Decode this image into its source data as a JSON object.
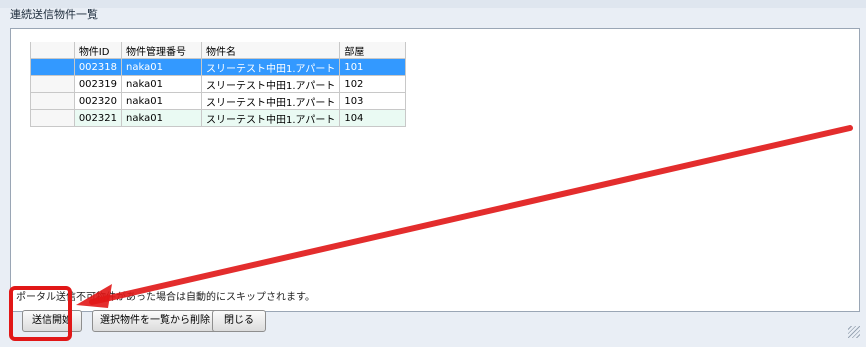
{
  "window": {
    "title": "連続送信物件一覧"
  },
  "table": {
    "headers": [
      "物件ID",
      "物件管理番号",
      "物件名",
      "部屋"
    ],
    "rows": [
      [
        "002318",
        "naka01",
        "スリーテスト中田1.アパート",
        "101"
      ],
      [
        "002319",
        "naka01",
        "スリーテスト中田1.アパート",
        "102"
      ],
      [
        "002320",
        "naka01",
        "スリーテスト中田1.アパート",
        "103"
      ],
      [
        "002321",
        "naka01",
        "スリーテスト中田1.アパート",
        "104"
      ]
    ],
    "selected_row": 0
  },
  "footer": {
    "note": "ポータル送信不可物件があった場合は自動的にスキップされます。"
  },
  "buttons": {
    "start": "送信開始",
    "remove": "選択物件を一覧から削除",
    "close": "閉じる"
  },
  "annotation": {
    "color": "#e11717"
  }
}
